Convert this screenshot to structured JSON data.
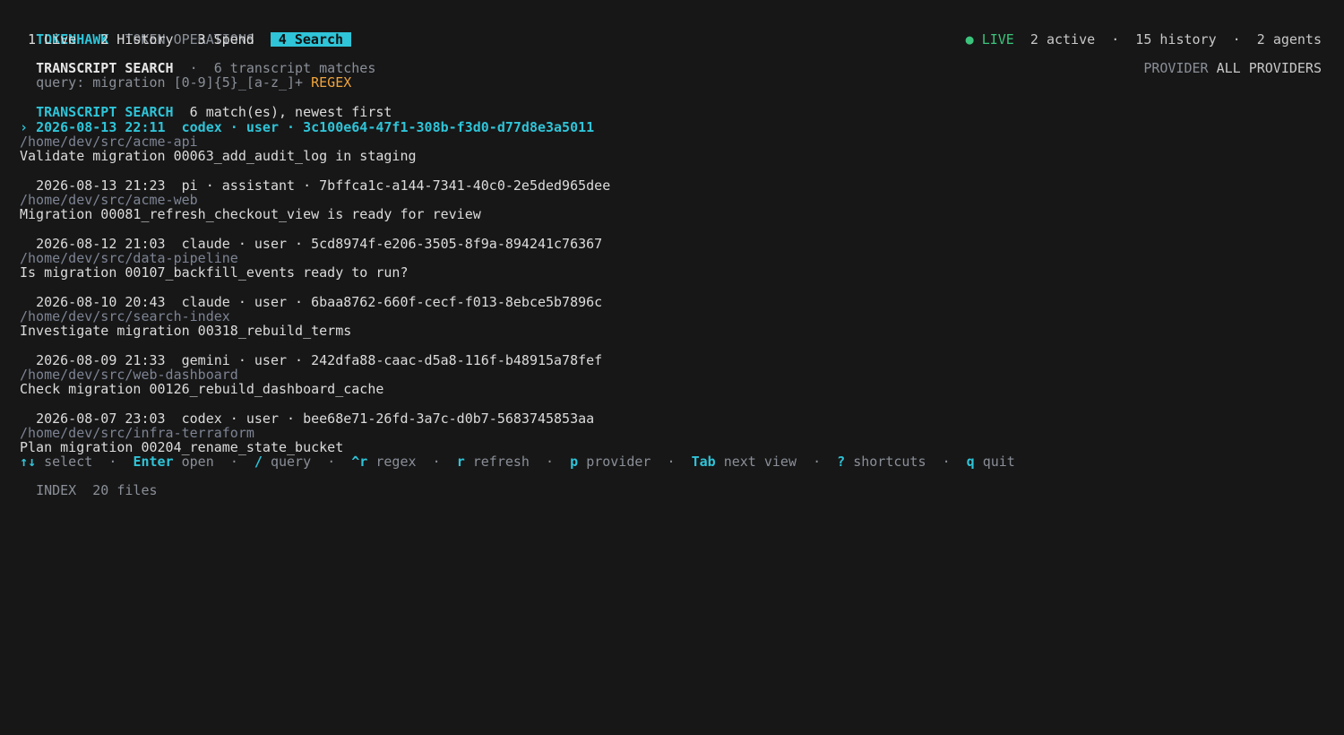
{
  "header": {
    "brand": "TOKENHAWK",
    "subtitle": "TOKEN OPERATIONS",
    "live_dot": "●",
    "live_label": "LIVE",
    "stats": "2 active  ·  15 history  ·  2 agents",
    "provider_label": "PROVIDER",
    "provider_value": "ALL PROVIDERS"
  },
  "tabs": [
    {
      "label": "1 Live",
      "active": false
    },
    {
      "label": "2 History",
      "active": false
    },
    {
      "label": "3 Spend",
      "active": false
    },
    {
      "label": "4 Search",
      "active": true
    }
  ],
  "view": {
    "title": "TRANSCRIPT SEARCH",
    "sep": "·",
    "summary": "6 transcript matches",
    "query_label": "query:",
    "query_value": "migration [0-9]{5}_[a-z_]+",
    "query_mode": "REGEX"
  },
  "results": {
    "title": "TRANSCRIPT SEARCH",
    "summary": "6 match(es), newest first",
    "items": [
      {
        "selected": true,
        "marker": "›",
        "header": "2026-08-13 22:11  codex · user · 3c100e64-47f1-308b-f3d0-d77d8e3a5011",
        "path": "/home/dev/src/acme-api",
        "text": "Validate migration 00063_add_audit_log in staging"
      },
      {
        "selected": false,
        "marker": " ",
        "header": "2026-08-13 21:23  pi · assistant · 7bffca1c-a144-7341-40c0-2e5ded965dee",
        "path": "/home/dev/src/acme-web",
        "text": "Migration 00081_refresh_checkout_view is ready for review"
      },
      {
        "selected": false,
        "marker": " ",
        "header": "2026-08-12 21:03  claude · user · 5cd8974f-e206-3505-8f9a-894241c76367",
        "path": "/home/dev/src/data-pipeline",
        "text": "Is migration 00107_backfill_events ready to run?"
      },
      {
        "selected": false,
        "marker": " ",
        "header": "2026-08-10 20:43  claude · user · 6baa8762-660f-cecf-f013-8ebce5b7896c",
        "path": "/home/dev/src/search-index",
        "text": "Investigate migration 00318_rebuild_terms"
      },
      {
        "selected": false,
        "marker": " ",
        "header": "2026-08-09 21:33  gemini · user · 242dfa88-caac-d5a8-116f-b48915a78fef",
        "path": "/home/dev/src/web-dashboard",
        "text": "Check migration 00126_rebuild_dashboard_cache"
      },
      {
        "selected": false,
        "marker": " ",
        "header": "2026-08-07 23:03  codex · user · bee68e71-26fd-3a7c-d0b7-5683745853aa",
        "path": "/home/dev/src/infra-terraform",
        "text": "Plan migration 00204_rename_state_bucket"
      }
    ]
  },
  "shortcuts": [
    {
      "key": "↑↓",
      "label": "select"
    },
    {
      "key": "Enter",
      "label": "open"
    },
    {
      "key": "/",
      "label": "query"
    },
    {
      "key": "^r",
      "label": "regex"
    },
    {
      "key": "r",
      "label": "refresh"
    },
    {
      "key": "p",
      "label": "provider"
    },
    {
      "key": "Tab",
      "label": "next view"
    },
    {
      "key": "?",
      "label": "shortcuts"
    },
    {
      "key": "q",
      "label": "quit"
    }
  ],
  "shortcut_sep": "·",
  "footer": {
    "index_label": "INDEX",
    "index_value": "20 files"
  },
  "colors": {
    "background": "#171717",
    "accent": "#2fc4d8",
    "live": "#3cc47c",
    "regex": "#f0a43c",
    "muted": "#8a8f98"
  }
}
